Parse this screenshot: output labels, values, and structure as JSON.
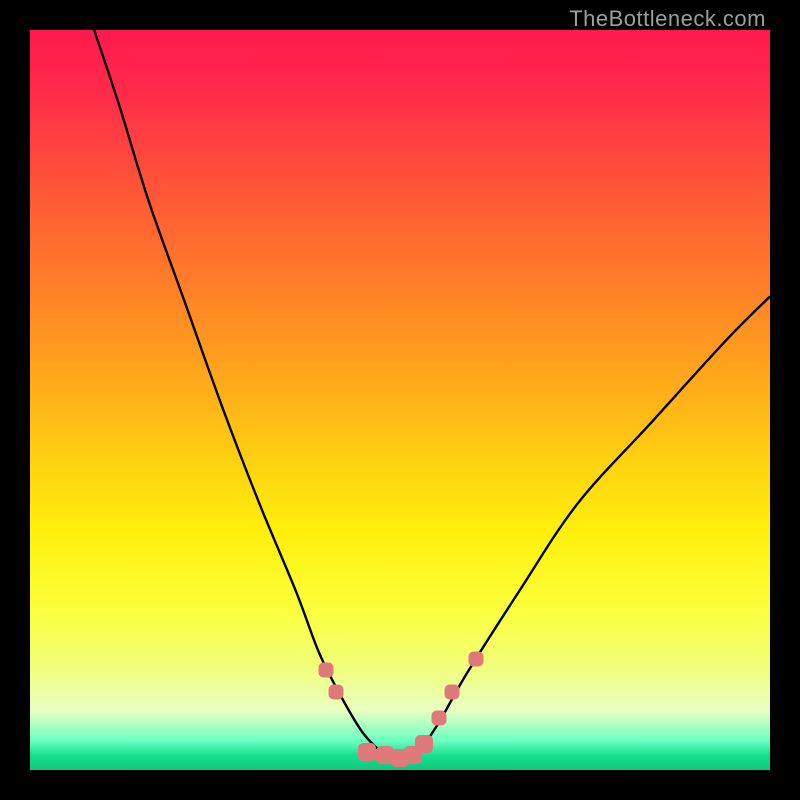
{
  "watermark": "TheBottleneck.com",
  "chart_data": {
    "type": "line",
    "title": "",
    "xlabel": "",
    "ylabel": "",
    "xlim": [
      0,
      100
    ],
    "ylim": [
      0,
      100
    ],
    "grid": false,
    "legend": false,
    "series": [
      {
        "name": "curve",
        "x": [
          8,
          12,
          16,
          21,
          26,
          31,
          36,
          39,
          42,
          45,
          48,
          50,
          52,
          55,
          59,
          66,
          74,
          84,
          94,
          100
        ],
        "y": [
          102,
          90,
          77,
          63,
          49,
          36,
          24,
          16,
          10,
          5,
          2,
          1,
          2,
          6,
          13,
          24,
          36,
          47,
          58,
          64
        ]
      }
    ],
    "annotations": {
      "markers_xy": [
        [
          40,
          13.5
        ],
        [
          41.3,
          10.5
        ],
        [
          55.3,
          7
        ],
        [
          57,
          10.5
        ],
        [
          60.3,
          15
        ],
        [
          45.5,
          2.5
        ],
        [
          48,
          2
        ],
        [
          50,
          1.6
        ],
        [
          51.8,
          2
        ],
        [
          53.2,
          3.5
        ]
      ]
    },
    "background": "rainbow-gradient"
  }
}
